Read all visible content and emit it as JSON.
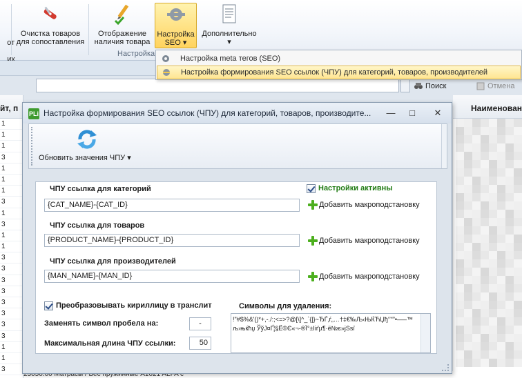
{
  "ribbon": {
    "partial_left_label_1": "от",
    "partial_left_label_2": "их",
    "compare_cleanup": "Очистка товаров\nдля сопоставления",
    "availability_display": "Отображение\nналичия товара",
    "seo_settings": "Настройка\nSEO ▾",
    "additional": "Дополнительно\n▾",
    "group_label": "Настройка"
  },
  "dropdown": {
    "items": [
      {
        "label": "Настройка meta тегов (SEO)"
      },
      {
        "label": "Настройка формирования SEO ссылок (ЧПУ) для категорий, товаров, производителей"
      }
    ]
  },
  "search": {
    "search_label": "Поиск",
    "cancel_label": "Отмена"
  },
  "background_table": {
    "left_header": "йт, п",
    "left_rows": [
      "1",
      "1",
      "1",
      "3",
      "1",
      "1",
      "1",
      "3",
      "1",
      "3",
      "1",
      "1",
      "3",
      "3",
      "3",
      "3",
      "3",
      "3",
      "3",
      "3",
      "1",
      "1",
      "3"
    ],
    "right_header": "Наименован",
    "bottom_row_text": "23050.00    Матрасы / Бес пружинные                                                                                        A1021 ALFA с",
    "pixel_colors": [
      "#f1f1f1",
      "#e3e3e3",
      "#ededed",
      "#d9d9d9",
      "#f4f4f4",
      "#e8e8e8",
      "#dcdcdc",
      "#efefef"
    ]
  },
  "dialog": {
    "app_icon_text": "PLi",
    "title": "Настройка формирования SEO ссылок (ЧПУ) для категорий, товаров, производите...",
    "minimize": "—",
    "maximize": "□",
    "close": "✕",
    "toolbar": {
      "refresh_label": "Обновить значения ЧПУ ▾"
    },
    "form": {
      "category_label": "ЧПУ ссылка для категорий",
      "category_value": "{CAT_NAME}-{CAT_ID}",
      "product_label": "ЧПУ ссылка для товаров",
      "product_value": "{PRODUCT_NAME}-{PRODUCT_ID}",
      "manufacturer_label": "ЧПУ ссылка для производителей",
      "manufacturer_value": "{MAN_NAME}-{MAN_ID}",
      "add_macro": "Добавить макроподстановку",
      "settings_active": "Настройки активны",
      "translit_label": "Преобразовывать кириллицу в транслит",
      "space_replace_label": "Заменять символ пробела на:",
      "space_replace_value": "-",
      "max_length_label": "Максимальная длина ЧПУ ссылки:",
      "max_length_value": "50",
      "symbols_label": "Символы для удаления:",
      "symbols_value": "!\"#$%&'()*+,-./:;<=>?@[\\]^_`{|}~ЂЃ‚ѓ„…†‡€‰Љ‹ЊЌЋЏђ‘’“”•–—™љ›њќћџ ЎўЈ¤Ґ¦§Ё©Є«¬-®Ї°±Ііґµ¶·ё№є»јЅѕї"
    },
    "colors": {
      "accent_green": "#1f7a12",
      "highlight": "#ffe591"
    }
  }
}
